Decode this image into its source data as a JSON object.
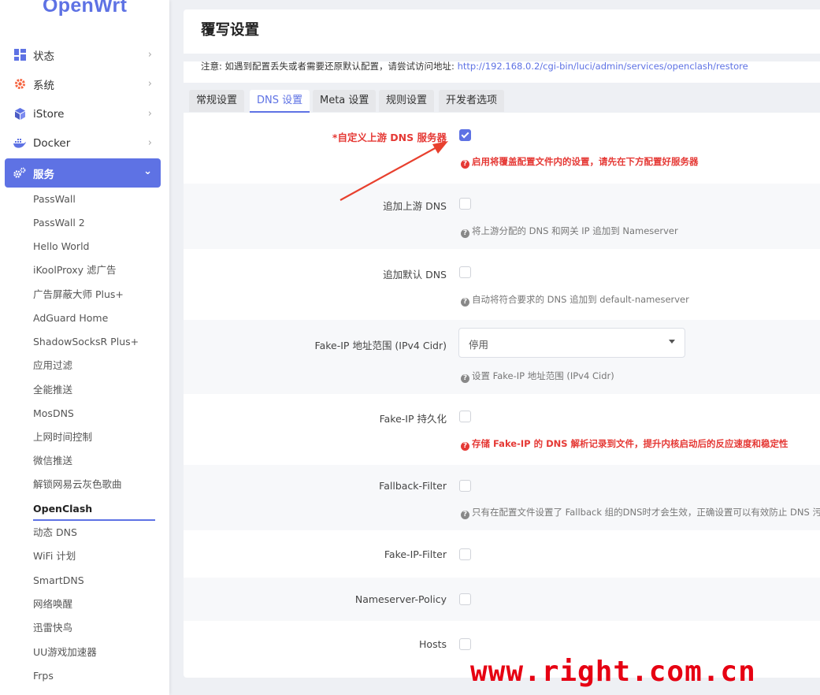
{
  "sidebar": {
    "logo": "OpenWrt",
    "menu": [
      {
        "label": "状态",
        "icon": "dashboard-icon"
      },
      {
        "label": "系统",
        "icon": "gear-icon"
      },
      {
        "label": "iStore",
        "icon": "cube-icon"
      },
      {
        "label": "Docker",
        "icon": "docker-icon"
      },
      {
        "label": "服务",
        "icon": "cogs-icon"
      }
    ],
    "services": [
      "PassWall",
      "PassWall 2",
      "Hello World",
      "iKoolProxy 滤广告",
      "广告屏蔽大师 Plus+",
      "AdGuard Home",
      "ShadowSocksR Plus+",
      "应用过滤",
      "全能推送",
      "MosDNS",
      "上网时间控制",
      "微信推送",
      "解锁网易云灰色歌曲",
      "OpenClash",
      "动态 DNS",
      "WiFi 计划",
      "SmartDNS",
      "网络唤醒",
      "迅雷快鸟",
      "UU游戏加速器",
      "Frps"
    ]
  },
  "main": {
    "title": "覆写设置",
    "notice_text": "注意: 如遇到配置丢失或者需要还原默认配置，请尝试访问地址: ",
    "notice_link": "http://192.168.0.2/cgi-bin/luci/admin/services/openclash/restore",
    "tabs": [
      "常规设置",
      "DNS 设置",
      "Meta 设置",
      "规则设置",
      "开发者选项"
    ],
    "active_tab": "DNS 设置",
    "fields": {
      "custom_dns": {
        "label": "*自定义上游 DNS 服务器",
        "checked": true,
        "help": "启用将覆盖配置文件内的设置，请先在下方配置好服务器"
      },
      "append_upstream_dns": {
        "label": "追加上游 DNS",
        "checked": false,
        "help": "将上游分配的 DNS 和网关 IP 追加到 Nameserver"
      },
      "append_default_dns": {
        "label": "追加默认 DNS",
        "checked": false,
        "help": "自动将符合要求的 DNS 追加到 default-nameserver"
      },
      "fake_ip_range": {
        "label": "Fake-IP 地址范围 (IPv4 Cidr)",
        "value": "停用",
        "help": "设置 Fake-IP 地址范围 (IPv4 Cidr)"
      },
      "fake_ip_persist": {
        "label": "Fake-IP 持久化",
        "checked": false,
        "help": "存储 Fake-IP 的 DNS 解析记录到文件，提升内核启动后的反应速度和稳定性"
      },
      "fallback_filter": {
        "label": "Fallback-Filter",
        "checked": false,
        "help": "只有在配置文件设置了 Fallback 组的DNS时才会生效，正确设置可以有效防止 DNS 污染"
      },
      "fake_ip_filter": {
        "label": "Fake-IP-Filter",
        "checked": false
      },
      "nameserver_policy": {
        "label": "Nameserver-Policy",
        "checked": false
      },
      "hosts": {
        "label": "Hosts",
        "checked": false
      }
    },
    "help_mark": "?"
  },
  "watermark": "www.right.com.cn",
  "colors": {
    "accent": "#5e72e4",
    "required": "#e53935",
    "watermark": "#e60012"
  }
}
